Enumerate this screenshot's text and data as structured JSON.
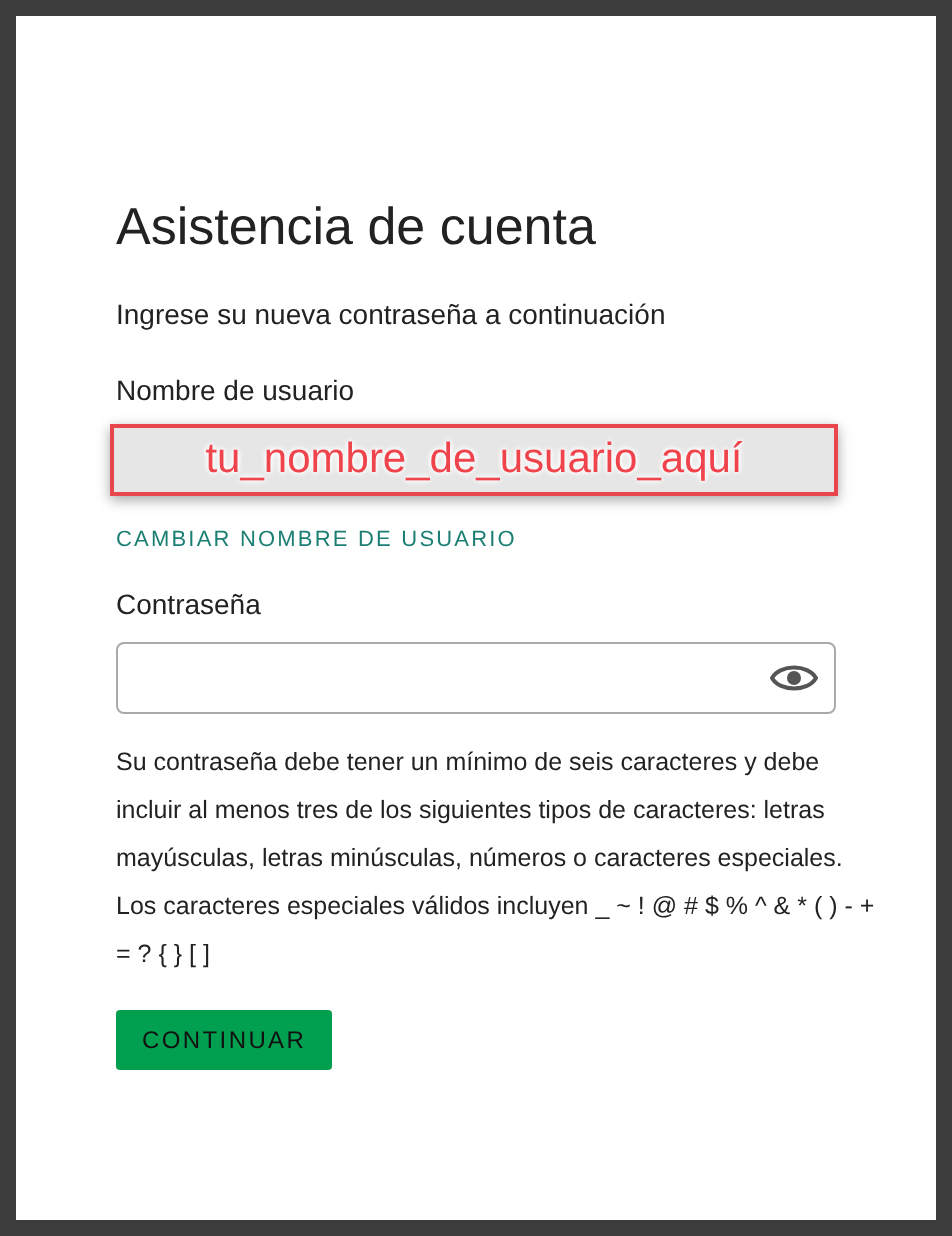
{
  "title": "Asistencia de cuenta",
  "subtitle": "Ingrese su nueva contraseña a continuación",
  "username": {
    "label": "Nombre de usuario",
    "value": "tu_nombre_de_usuario_aquí"
  },
  "change_username_link": "CAMBIAR NOMBRE DE USUARIO",
  "password": {
    "label": "Contraseña"
  },
  "requirements": "Su contraseña debe tener un mínimo de seis caracteres y debe incluir al menos tres de los siguientes tipos de caracteres: letras mayúsculas, letras minúsculas, números o caracteres especiales. Los caracteres especiales válidos incluyen _ ~ ! @ # $ % ^ & * ( ) - + = ? { } [ ]",
  "button": "CONTINUAR"
}
